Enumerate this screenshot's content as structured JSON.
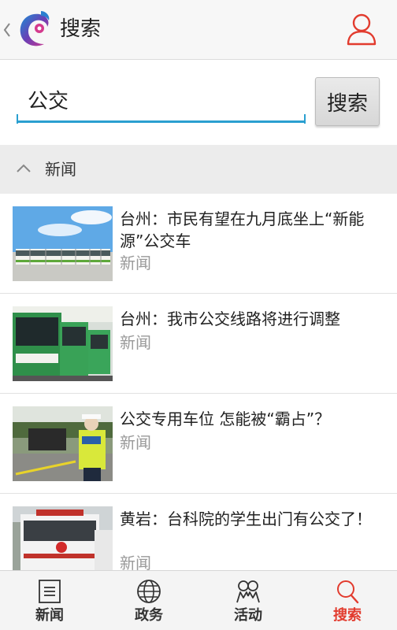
{
  "header": {
    "title": "搜索"
  },
  "search": {
    "value": "公交",
    "button_label": "搜索"
  },
  "section": {
    "title": "新闻"
  },
  "news": [
    {
      "title": "台州：市民有望在九月底坐上“新能源”公交车",
      "category": "新闻"
    },
    {
      "title": "台州：我市公交线路将进行调整",
      "category": "新闻"
    },
    {
      "title": "公交专用车位 怎能被“霸占”？",
      "category": "新闻"
    },
    {
      "title": "黄岩：台科院的学生出门有公交了！",
      "category": "新闻"
    }
  ],
  "tabs": [
    {
      "label": "新闻",
      "icon": "news-icon"
    },
    {
      "label": "政务",
      "icon": "globe-icon"
    },
    {
      "label": "活动",
      "icon": "people-icon"
    },
    {
      "label": "搜索",
      "icon": "search-icon",
      "active": true
    }
  ],
  "colors": {
    "accent": "#e23b2e",
    "input_underline": "#2a9fd0"
  }
}
